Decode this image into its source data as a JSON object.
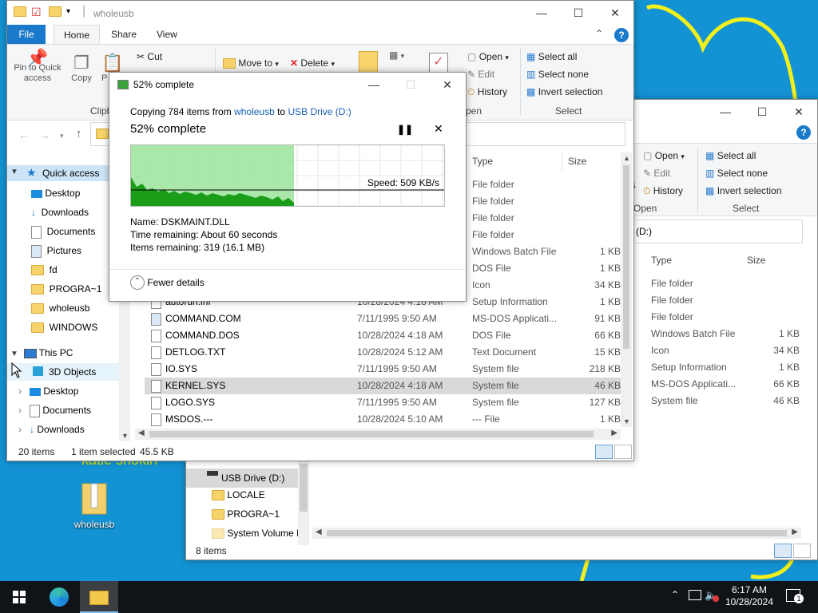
{
  "desktop": {
    "icon_label": "wholeusb",
    "bg_text": "katie shokin"
  },
  "main_window": {
    "title": "wholeusb",
    "tabs": [
      "File",
      "Home",
      "Share",
      "View"
    ],
    "ribbon": {
      "pin_label": "Pin to Quick access",
      "copy_label": "Copy",
      "paste_label": "P",
      "cut_label": "Cut",
      "clipboard_group": "Clipb",
      "move_to_label": "Move to",
      "delete_label": "Delete",
      "open_label": "Open",
      "edit_label": "Edit",
      "history_label": "History",
      "open_group": "pen",
      "select_all_label": "Select all",
      "select_none_label": "Select none",
      "invert_selection_label": "Invert selection",
      "select_group": "Select"
    },
    "nav": {
      "quick_access": "Quick access",
      "items": [
        "Desktop",
        "Downloads",
        "Documents",
        "Pictures",
        "fd",
        "PROGRA~1",
        "wholeusb",
        "WINDOWS"
      ],
      "this_pc": "This PC",
      "pc_items": [
        "3D Objects",
        "Desktop",
        "Documents",
        "Downloads"
      ]
    },
    "columns": {
      "type": "Type",
      "size": "Size"
    },
    "rows_top": [
      {
        "type": "File folder",
        "size": ""
      },
      {
        "type": "File folder",
        "size": ""
      },
      {
        "type": "File folder",
        "size": ""
      },
      {
        "type": "File folder",
        "size": ""
      },
      {
        "type": "Windows Batch File",
        "size": "1 KB"
      },
      {
        "type": "DOS File",
        "size": "1 KB"
      },
      {
        "type": "Icon",
        "size": "34 KB"
      }
    ],
    "rows": [
      {
        "name": "autorun.inf",
        "date": "10/28/2024 4:18 AM",
        "type": "Setup Information",
        "size": "1 KB"
      },
      {
        "name": "COMMAND.COM",
        "date": "7/11/1995 9:50 AM",
        "type": "MS-DOS Applicati...",
        "size": "91 KB"
      },
      {
        "name": "COMMAND.DOS",
        "date": "10/28/2024 4:18 AM",
        "type": "DOS File",
        "size": "66 KB"
      },
      {
        "name": "DETLOG.TXT",
        "date": "10/28/2024 5:12 AM",
        "type": "Text Document",
        "size": "15 KB"
      },
      {
        "name": "IO.SYS",
        "date": "7/11/1995 9:50 AM",
        "type": "System file",
        "size": "218 KB"
      },
      {
        "name": "KERNEL.SYS",
        "date": "10/28/2024 4:18 AM",
        "type": "System file",
        "size": "46 KB"
      },
      {
        "name": "LOGO.SYS",
        "date": "7/11/1995 9:50 AM",
        "type": "System file",
        "size": "127 KB"
      },
      {
        "name": "MSDOS.---",
        "date": "10/28/2024 5:10 AM",
        "type": "--- File",
        "size": "1 KB"
      }
    ],
    "status": {
      "count": "20 items",
      "selected": "1 item selected",
      "selected_size": "45.5 KB"
    }
  },
  "second_window": {
    "ribbon": {
      "open_label": "Open",
      "edit_label": "Edit",
      "history_label": "History",
      "open_group": "Open",
      "select_all_label": "Select all",
      "select_none_label": "Select none",
      "invert_selection_label": "Invert selection",
      "select_group": "Select",
      "partial": "es"
    },
    "address": "(D:)",
    "columns": {
      "type": "Type",
      "size": "Size"
    },
    "rows": [
      {
        "type": "File folder",
        "size": ""
      },
      {
        "type": "File folder",
        "size": ""
      },
      {
        "type": "File folder",
        "size": ""
      },
      {
        "type": "Windows Batch File",
        "size": "1 KB"
      },
      {
        "type": "Icon",
        "size": "34 KB"
      },
      {
        "type": "Setup Information",
        "size": "1 KB"
      },
      {
        "type": "MS-DOS Applicati...",
        "size": "66 KB"
      },
      {
        "type": "System file",
        "size": "46 KB"
      }
    ],
    "nav": {
      "drive": "USB Drive (D:)",
      "items": [
        "LOCALE",
        "PROGRA~1",
        "System Volume I"
      ]
    },
    "status": {
      "count": "8 items"
    }
  },
  "copy_dialog": {
    "title": "52% complete",
    "copying_prefix": "Copying 784 items from ",
    "source": "wholeusb",
    "to_word": " to ",
    "destination": "USB Drive (D:)",
    "percent_text": "52% complete",
    "progress": 0.52,
    "speed": "Speed: 509 KB/s",
    "name_line": "Name:  DSKMAINT.DLL",
    "time_line": "Time remaining:  About 60 seconds",
    "items_line": "Items remaining:  319 (16.1 MB)",
    "fewer_details": "Fewer details"
  },
  "taskbar": {
    "time": "6:17 AM",
    "date": "10/28/2024",
    "notification_count": "1"
  },
  "colors": {
    "accent": "#1979ca",
    "desktop": "#1393d3",
    "progress_fill": "#9be39b",
    "progress_graph": "#1a9e1a"
  }
}
